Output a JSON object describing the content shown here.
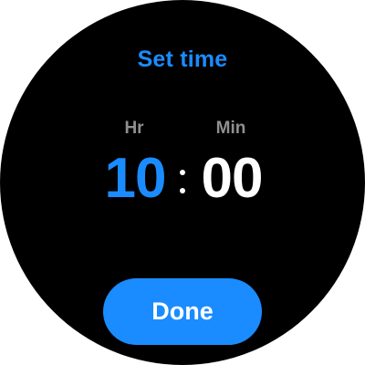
{
  "dialog": {
    "title": "Set time"
  },
  "picker": {
    "hour_label": "Hr",
    "minute_label": "Min",
    "hour_value": "10",
    "minute_value": "00",
    "separator": ":"
  },
  "actions": {
    "done_label": "Done"
  },
  "colors": {
    "accent": "#1a8cff",
    "background": "#000000",
    "label_gray": "#8f8f8f",
    "text_white": "#ffffff"
  }
}
